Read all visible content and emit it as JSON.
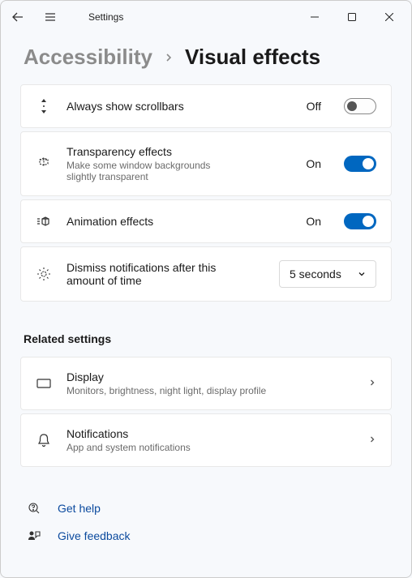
{
  "app": {
    "title": "Settings"
  },
  "breadcrumb": {
    "parent": "Accessibility",
    "current": "Visual effects"
  },
  "rows": {
    "scrollbars": {
      "label": "Always show scrollbars",
      "state": "Off"
    },
    "transparency": {
      "label": "Transparency effects",
      "desc": "Make some window backgrounds slightly transparent",
      "state": "On"
    },
    "animation": {
      "label": "Animation effects",
      "state": "On"
    },
    "dismiss": {
      "label": "Dismiss notifications after this amount of time",
      "value": "5 seconds"
    }
  },
  "related": {
    "title": "Related settings",
    "display": {
      "label": "Display",
      "desc": "Monitors, brightness, night light, display profile"
    },
    "notifications": {
      "label": "Notifications",
      "desc": "App and system notifications"
    }
  },
  "links": {
    "help": "Get help",
    "feedback": "Give feedback"
  }
}
